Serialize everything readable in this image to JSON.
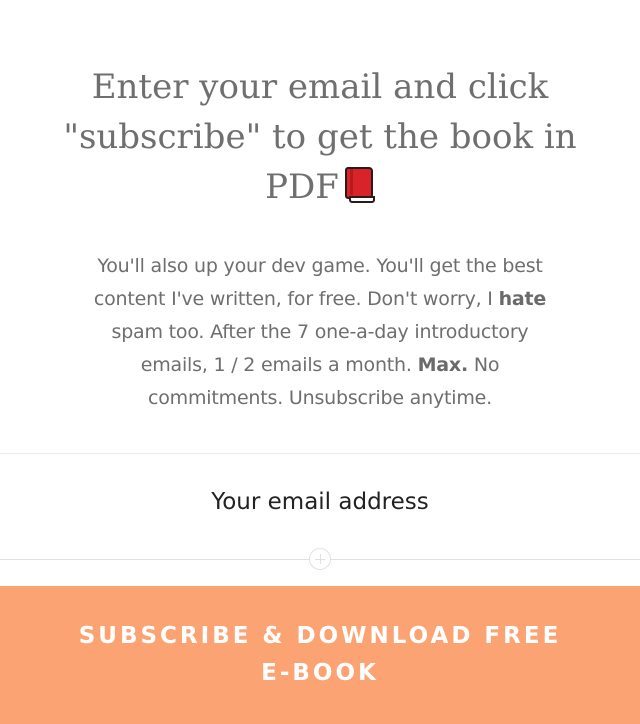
{
  "headline": {
    "text": "Enter your email and click \"subscribe\" to get the book in PDF",
    "icon": "red-book-icon"
  },
  "description": {
    "part1": "You'll also up your dev game. You'll get the best content I've written, for free. Don't worry, I ",
    "bold1": "hate",
    "part2": " spam too. After the 7 one-a-day introductory emails, 1 / 2 emails a month. ",
    "bold2": "Max.",
    "part3": " No commitments. Unsubscribe anytime."
  },
  "email_field": {
    "placeholder": "Your email address",
    "value": ""
  },
  "subscribe_button": {
    "label": "SUBSCRIBE & DOWNLOAD FREE E-BOOK"
  },
  "colors": {
    "button_background": "#fca374",
    "headline_text": "#6f6f6f",
    "body_text": "#6e6e6e"
  }
}
